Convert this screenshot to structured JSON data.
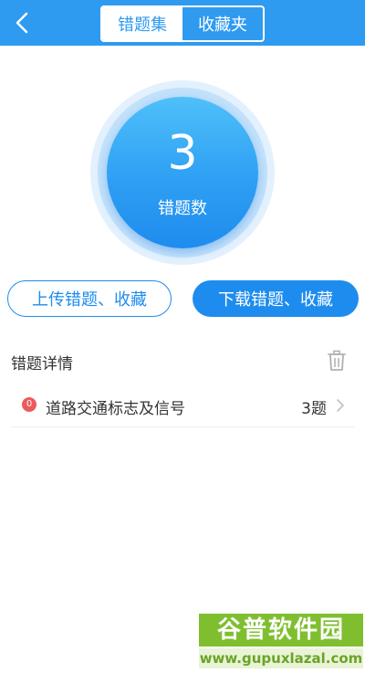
{
  "header": {
    "tabs": [
      {
        "label": "错题集",
        "active": true
      },
      {
        "label": "收藏夹",
        "active": false
      }
    ]
  },
  "stats": {
    "count": "3",
    "label": "错题数"
  },
  "actions": {
    "upload_label": "上传错题、收藏",
    "download_label": "下载错题、收藏"
  },
  "details": {
    "title": "错题详情",
    "items": [
      {
        "badge": "0",
        "title": "道路交通标志及信号",
        "count": "3题"
      }
    ]
  },
  "watermark": {
    "brand": "谷普软件园",
    "url": "www.gupuxlazal.com"
  },
  "colors": {
    "header": "#2f9bf0",
    "accent": "#1e8cee",
    "badge": "#ec5b5b"
  }
}
